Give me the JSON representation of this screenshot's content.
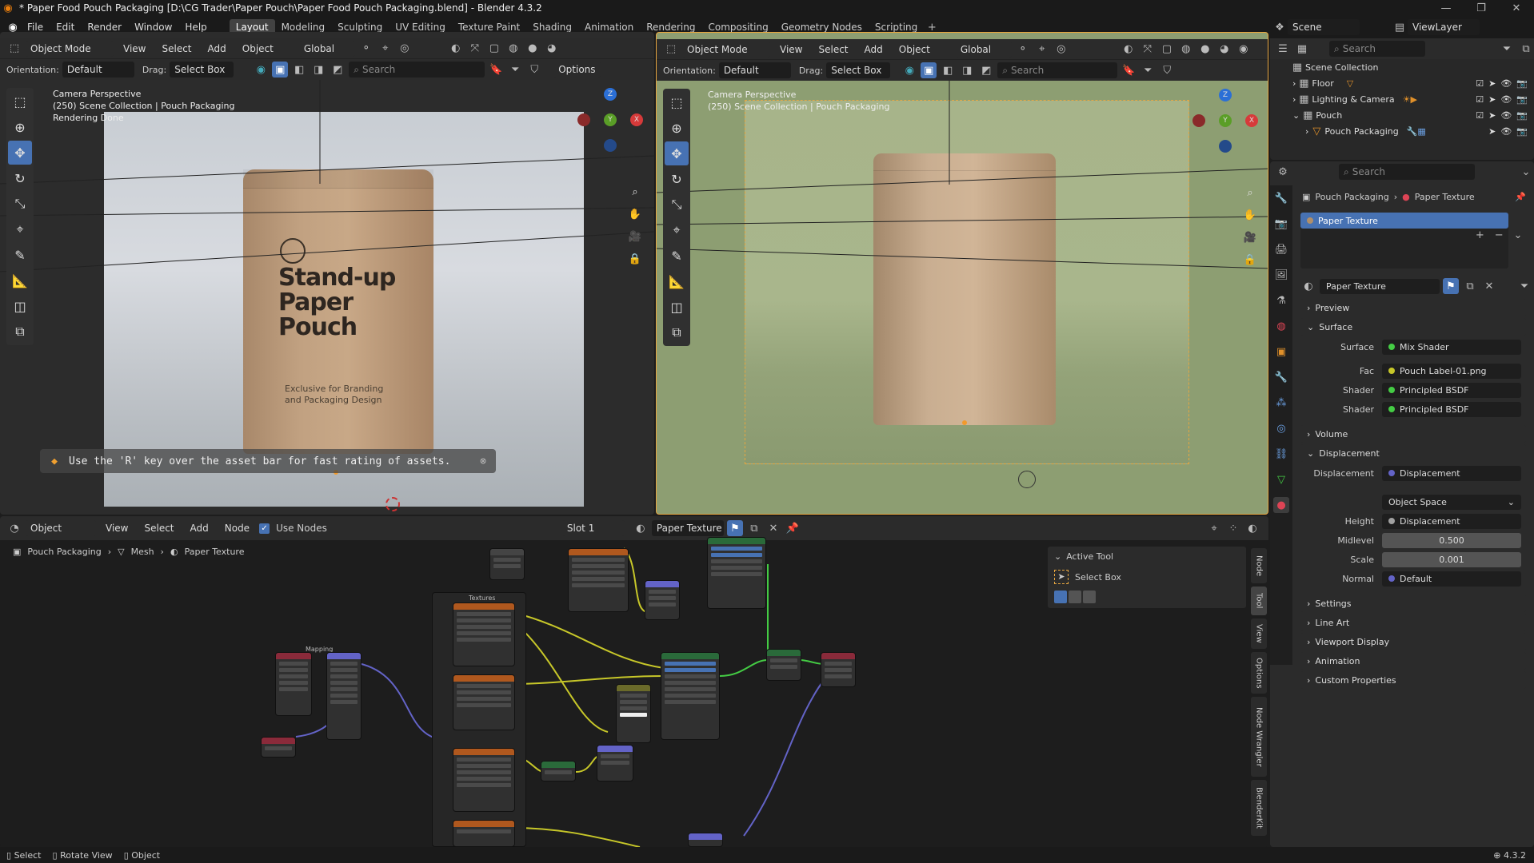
{
  "window": {
    "title": "* Paper Food Pouch Packaging [D:\\CG Trader\\Paper Pouch\\Paper Food Pouch Packaging.blend] - Blender 4.3.2"
  },
  "menu": {
    "items": [
      "File",
      "Edit",
      "Render",
      "Window",
      "Help"
    ],
    "workspaces": [
      "Layout",
      "Modeling",
      "Sculpting",
      "UV Editing",
      "Texture Paint",
      "Shading",
      "Animation",
      "Rendering",
      "Compositing",
      "Geometry Nodes",
      "Scripting"
    ],
    "active_workspace": "Layout",
    "scene": "Scene",
    "view_layer": "ViewLayer"
  },
  "viewport_left": {
    "mode": "Object Mode",
    "menus": [
      "View",
      "Select",
      "Add",
      "Object"
    ],
    "transform": "Global",
    "orientation_label": "Orientation:",
    "orientation_value": "Default",
    "drag_label": "Drag:",
    "drag_value": "Select Box",
    "search_placeholder": "Search",
    "options_label": "Options",
    "info_line1": "Camera Perspective",
    "info_line2": "(250) Scene Collection | Pouch Packaging",
    "info_line3": "Rendering Done",
    "pouch_title": "Stand-up Paper Pouch",
    "pouch_title_l1": "Stand-up",
    "pouch_title_l2": "Paper",
    "pouch_title_l3": "Pouch",
    "pouch_sub_l1": "Exclusive for Branding",
    "pouch_sub_l2": "and Packaging Design",
    "hint": "Use the 'R' key over the asset bar for fast rating of assets."
  },
  "viewport_right": {
    "mode": "Object Mode",
    "menus": [
      "View",
      "Select",
      "Add",
      "Object"
    ],
    "transform": "Global",
    "orientation_label": "Orientation:",
    "orientation_value": "Default",
    "drag_label": "Drag:",
    "drag_value": "Select Box",
    "search_placeholder": "Search",
    "info_line1": "Camera Perspective",
    "info_line2": "(250) Scene Collection | Pouch Packaging"
  },
  "outliner": {
    "search_placeholder": "Search",
    "root": "Scene Collection",
    "items": [
      {
        "label": "Floor"
      },
      {
        "label": "Lighting & Camera"
      },
      {
        "label": "Pouch"
      },
      {
        "label": "Pouch Packaging"
      }
    ]
  },
  "properties": {
    "search_placeholder": "Search",
    "breadcrumb_object": "Pouch Packaging",
    "breadcrumb_material": "Paper Texture",
    "slot_name": "Paper Texture",
    "material_name": "Paper Texture",
    "panels": {
      "preview": "Preview",
      "surface": "Surface",
      "volume": "Volume",
      "displacement": "Displacement",
      "settings": "Settings",
      "line_art": "Line Art",
      "viewport_display": "Viewport Display",
      "animation": "Animation",
      "custom_properties": "Custom Properties"
    },
    "surface_rows": [
      {
        "label": "Surface",
        "value": "Mix Shader"
      },
      {
        "label": "Fac",
        "value": "Pouch Label-01.png"
      },
      {
        "label": "Shader",
        "value": "Principled BSDF"
      },
      {
        "label": "Shader",
        "value": "Principled BSDF"
      }
    ],
    "displacement_rows": [
      {
        "label": "Displacement",
        "value": "Displacement"
      },
      {
        "label": "",
        "value": "Object Space"
      },
      {
        "label": "Height",
        "value": "Displacement"
      },
      {
        "label": "Midlevel",
        "value": "0.500"
      },
      {
        "label": "Scale",
        "value": "0.001"
      },
      {
        "label": "Normal",
        "value": "Default"
      }
    ]
  },
  "node_editor": {
    "editor_type": "Object",
    "menus": [
      "View",
      "Select",
      "Add",
      "Node"
    ],
    "use_nodes_label": "Use Nodes",
    "slot": "Slot 1",
    "material": "Paper Texture",
    "breadcrumb": [
      "Pouch Packaging",
      "Mesh",
      "Paper Texture"
    ],
    "frame_mapping": "Mapping",
    "frame_textures": "Textures",
    "active_tool_title": "Active Tool",
    "active_tool_value": "Select Box",
    "side_tabs": [
      "Node",
      "Tool",
      "View",
      "Options",
      "Node Wrangler",
      "BlenderKit"
    ]
  },
  "statusbar": {
    "items": [
      "Select",
      "Rotate View",
      "Object"
    ],
    "version": "4.3.2"
  },
  "colors": {
    "accent": "#4772b3",
    "bg": "#1d1d1d",
    "panel": "#2b2b2b"
  }
}
